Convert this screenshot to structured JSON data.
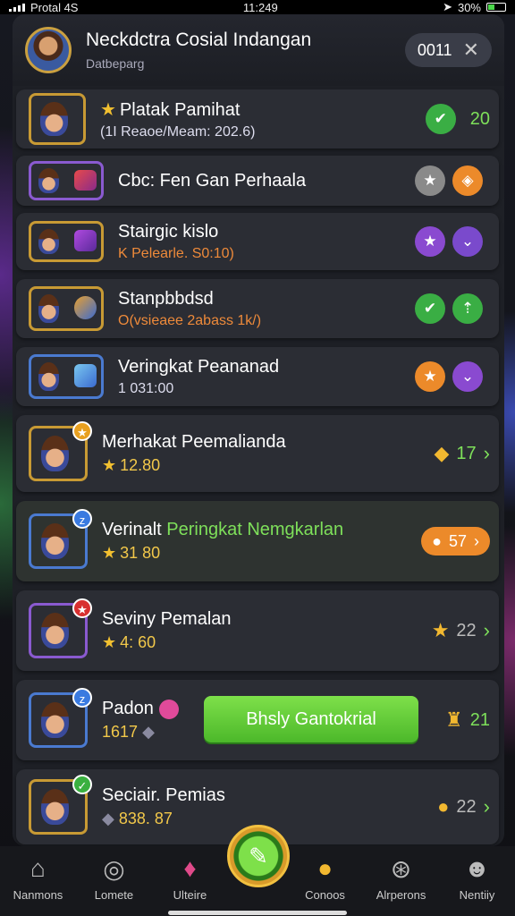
{
  "status": {
    "carrier": "Protal 4S",
    "time": "11:249",
    "battery": "30%"
  },
  "header": {
    "title": "Neckdctra Cosial Indangan",
    "subtitle": "Datbeparg",
    "counter": "0011",
    "close_icon": "close-icon"
  },
  "rows": [
    {
      "title": "Platak Pamihat",
      "sub": "(1I Reaoe/Meam: 202.6)",
      "right1": "check-icon",
      "right_value": "20"
    },
    {
      "title": "Cbc: Fen Gan Perhaala",
      "right1": "star-icon",
      "right2": "coin-icon"
    },
    {
      "title": "Stairgic kislo",
      "sub": "K Pelearle. S0:10)",
      "right1": "star-icon",
      "right2": "down-icon"
    },
    {
      "title": "Stanpbbdsd",
      "sub": "O(vsieaee 2abass 1k/)",
      "right1": "check-icon",
      "right2": "up-icon"
    },
    {
      "title": "Veringkat Peananad",
      "sub": "1 031:00",
      "right1": "star-icon",
      "right2": "down-icon"
    },
    {
      "title": "Merhakat Peemalianda",
      "sub": "12.80",
      "right_value": "17"
    },
    {
      "title_a": "Verinalt",
      "title_b": "Peringkat Nemgkarlan",
      "sub": "31 80",
      "right_value": "57"
    },
    {
      "title": "Seviny Pemalan",
      "sub": "4: 60",
      "right_value": "22"
    },
    {
      "title": "Padon",
      "sub": "1617",
      "button": "Bhsly Gantokrial",
      "right_value": "21"
    },
    {
      "title": "Seciair. Pemias",
      "sub": "838. 87",
      "right_value": "22"
    }
  ],
  "nav": [
    {
      "label": "Nanmons",
      "icon": "home-icon"
    },
    {
      "label": "Lomete",
      "icon": "target-icon"
    },
    {
      "label": "Ulteire",
      "icon": "gem-icon"
    },
    {
      "label": "Conoos",
      "icon": "coin-icon"
    },
    {
      "label": "Alrperons",
      "icon": "grid-icon"
    },
    {
      "label": "Nentiiy",
      "icon": "person-icon"
    }
  ]
}
